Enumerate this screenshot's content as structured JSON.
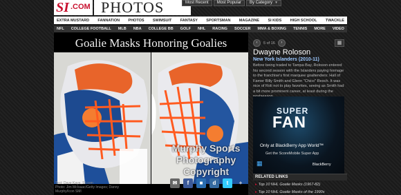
{
  "header": {
    "logo_si": "SI",
    "logo_com": ".COM",
    "section_title": "PHOTOS",
    "top_tabs": [
      {
        "label": "Most Recent"
      },
      {
        "label": "Most Popular"
      },
      {
        "label": "By Category"
      }
    ]
  },
  "nav_primary": [
    "EXTRA MUSTARD",
    "FANNATION",
    "PHOTOS",
    "SWIMSUIT",
    "FANTASY",
    "SPORTSMAN",
    "MAGAZINE",
    "SI KIDS",
    "HIGH SCHOOL",
    "TWACKLE"
  ],
  "nav_secondary": [
    "NFL",
    "COLLEGE FOOTBALL",
    "MLB",
    "NBA",
    "COLLEGE BB",
    "GOLF",
    "NHL",
    "RACING",
    "SOCCER",
    "MMA & BOXING",
    "TENNIS",
    "MORE",
    "VIDEO"
  ],
  "gallery": {
    "title": "Goalie Masks Honoring Goalies",
    "credit_line1": "Text: Dave Kaye, SI.com",
    "credit_line2": "Photo: Jim McIsaac/Getty Images; Danny",
    "credit_line3": "Murphy/Icon SMI",
    "watermark_line1": "Murphy Sports",
    "watermark_line2": "Photography",
    "watermark_line3": "Copyright",
    "jersey_number": "30"
  },
  "side": {
    "pager_prev": "‹",
    "pager_next": "›",
    "pager_count": "5 of 16",
    "player_name": "Dwayne Roloson",
    "player_team": "New York Islanders (2010-11)",
    "caption": "Before being traded to Tampa Bay, Roloson entered his second season with the Islanders paying homage to the franchise's first marquee goaltenders: Hall of Famer Billy Smith and Glenn \"Chico\" Resch. It was nice of Roli not to play favorites, seeing as Smith had a bit more prominent career, at least during the postseason."
  },
  "ad": {
    "super": "SUPER",
    "fan": "FAN",
    "line1": "Only at BlackBerry App World™",
    "line2": "Get the ScoreMobile Super App",
    "brand": "BlackBerry"
  },
  "related": {
    "heading": "RELATED LINKS",
    "items": [
      "Top 10 NHL Goalie Masks (1967-82)",
      "Top 10 NHL Goalie Masks of the 1990s"
    ]
  },
  "colors": {
    "accent_red": "#c8102e",
    "islanders_orange": "#f47d30",
    "islanders_blue": "#00539b"
  }
}
